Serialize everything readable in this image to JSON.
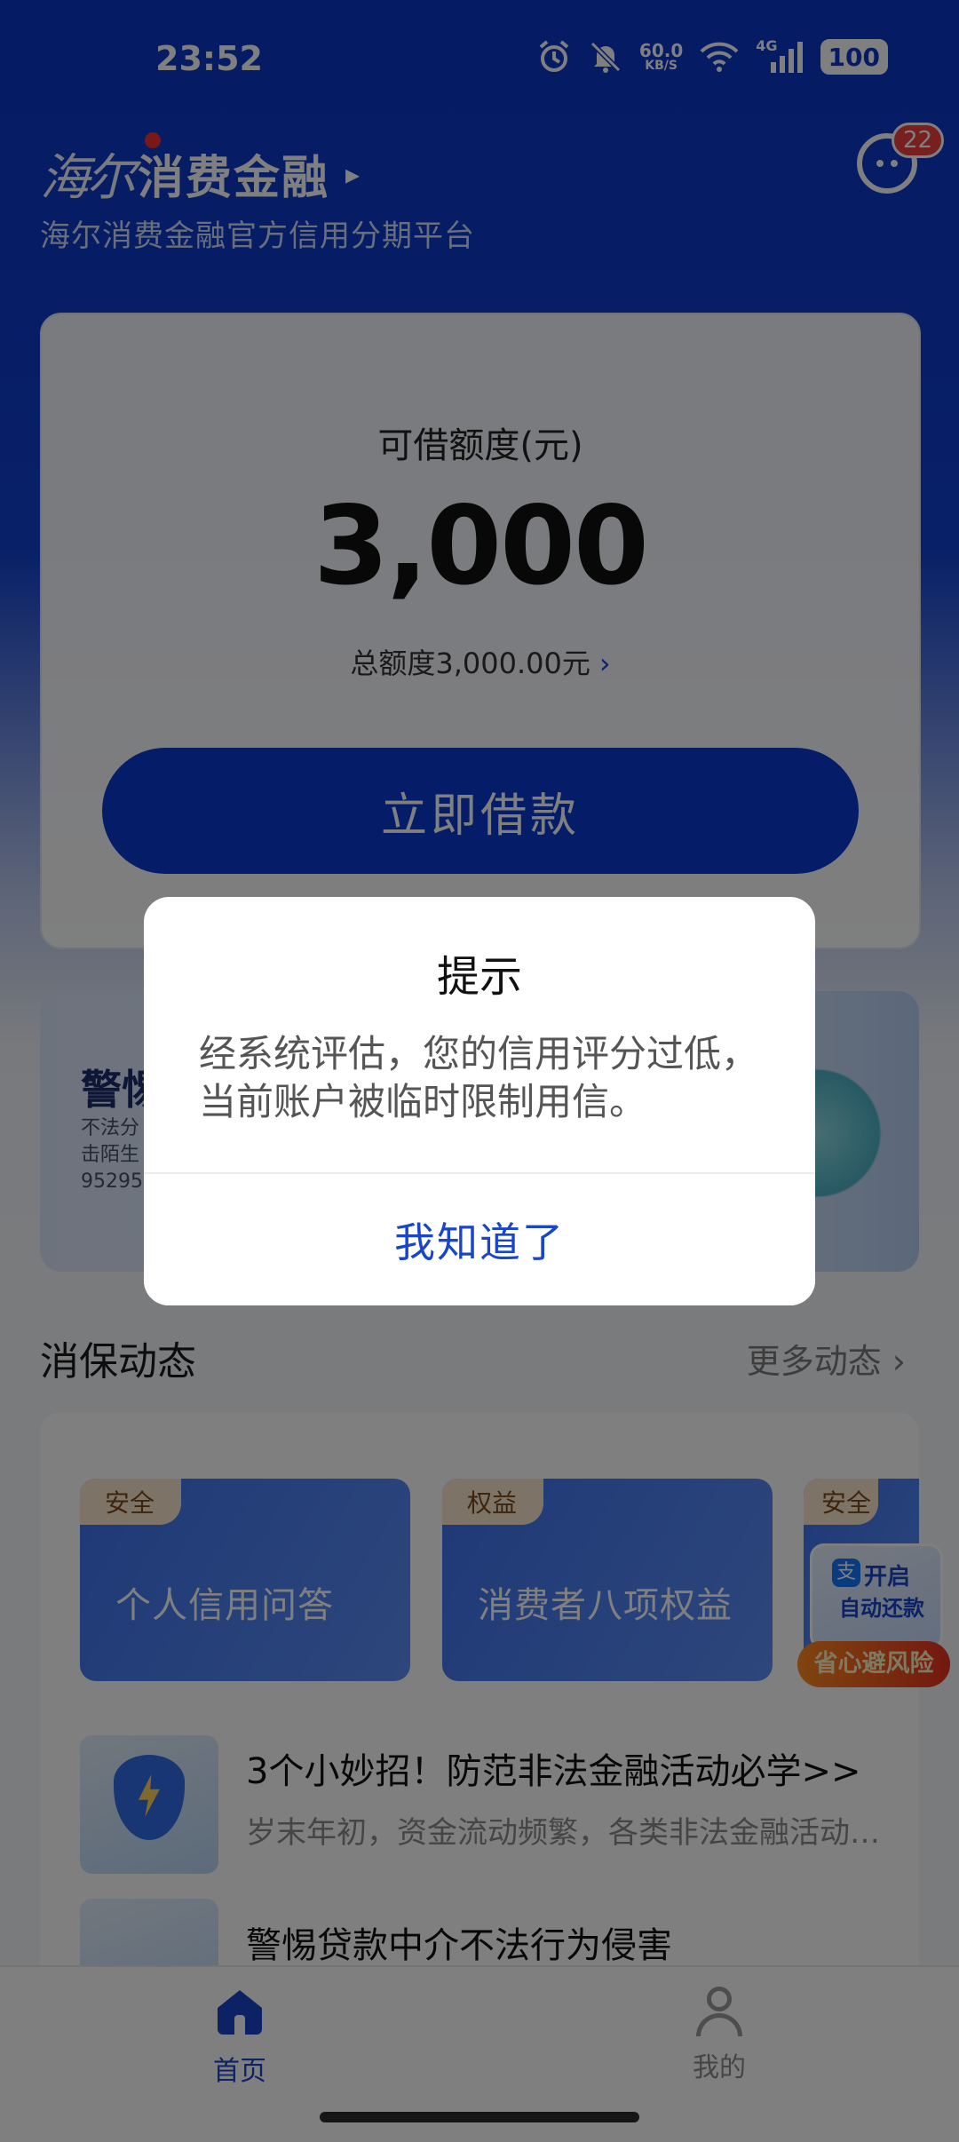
{
  "status_bar": {
    "time": "23:52",
    "net_speed_value": "60.0",
    "net_speed_unit": "KB/S",
    "network_type": "4G",
    "battery": "100",
    "icons": [
      "alarm-icon",
      "mute-icon",
      "wifi-icon",
      "signal-icon",
      "battery-icon"
    ]
  },
  "header": {
    "brand_script": "海尔",
    "brand_name": "消费金融",
    "subtitle": "海尔消费金融官方信用分期平台",
    "message_badge": "22"
  },
  "credit": {
    "label": "可借额度(元)",
    "amount": "3,000",
    "total": "总额度3,000.00元",
    "borrow_button": "立即借款"
  },
  "banner": {
    "title": "警惕",
    "text": "不法分\n击陌生\n95295"
  },
  "news": {
    "section_title": "消保动态",
    "more_link": "更多动态",
    "tiles": [
      {
        "tag": "安全",
        "label": "个人信用问答"
      },
      {
        "tag": "权益",
        "label": "消费者八项权益"
      },
      {
        "tag": "安全",
        "label": ""
      }
    ],
    "items": [
      {
        "title": "3个小妙招！防范非法金融活动必学>>",
        "desc": "岁末年初，资金流动频繁，各类非法金融活动层出不穷"
      },
      {
        "title": "警惕贷款中介不法行为侵害",
        "desc": ""
      }
    ]
  },
  "promo": {
    "line1": "开启",
    "line2": "自动还款",
    "ribbon": "省心避风险",
    "alipay_glyph": "支"
  },
  "bottom_nav": {
    "home": "首页",
    "me": "我的"
  },
  "dialog": {
    "title": "提示",
    "message": "经系统评估，您的信用评分过低，当前账户被临时限制用信。",
    "button": "我知道了"
  },
  "colors": {
    "brand_blue": "#0A3BD0",
    "link_blue": "#1845C9",
    "badge_red": "#F04040"
  }
}
